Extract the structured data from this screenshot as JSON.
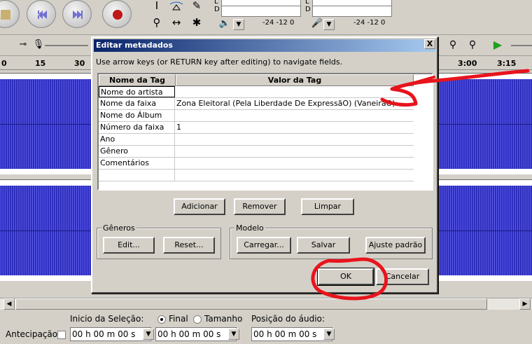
{
  "toolbar": {
    "meter_top_left_l": "L",
    "meter_top_left_d": "D",
    "meter_top_right_l": "L",
    "meter_top_right_d": "D",
    "meter_scale_a": "-24  -12  0",
    "meter_scale_b": "-24  -12  0"
  },
  "ruler": {
    "ticks": [
      "0",
      "15",
      "30",
      "3:00",
      "3:15"
    ]
  },
  "dialog": {
    "title": "Editar metadados",
    "close_label": "X",
    "hint": "Use arrow keys (or RETURN key after editing) to navigate fields.",
    "columns": [
      "Nome da Tag",
      "Valor da Tag"
    ],
    "rows": [
      {
        "key": "Nome do artista",
        "value": ""
      },
      {
        "key": "Nome da faixa",
        "value": "Zona Eleitoral (Pela Liberdade De ExpressãO) (VaneirãO)"
      },
      {
        "key": "Nome do Álbum",
        "value": ""
      },
      {
        "key": "Número da faixa",
        "value": "1"
      },
      {
        "key": "Ano",
        "value": ""
      },
      {
        "key": "Gênero",
        "value": ""
      },
      {
        "key": "Comentários",
        "value": ""
      }
    ],
    "buttons": {
      "add": "Adicionar",
      "remove": "Remover",
      "clear": "Limpar",
      "edit": "Edit...",
      "reset": "Reset...",
      "load": "Carregar...",
      "save": "Salvar",
      "set_default": "Ajuste padrão",
      "ok": "OK",
      "cancel": "Cancelar"
    },
    "groups": {
      "genres": "Gêneros",
      "template": "Modelo"
    }
  },
  "selection_bar": {
    "selection_start_label": "Inicio da Seleção:",
    "end_label": "Final",
    "length_label": "Tamanho",
    "audio_position_label": "Posição do áudio:",
    "anticipation_label": "Antecipação",
    "time_1": "00 h 00 m 00 s",
    "time_2": "00 h 00 m 00 s",
    "time_3": "00 h 00 m 00 s",
    "end_selected": true
  },
  "colors": {
    "title_bar": "#0a246a",
    "waveform": "#3232c8",
    "annotation": "#e8141c"
  }
}
